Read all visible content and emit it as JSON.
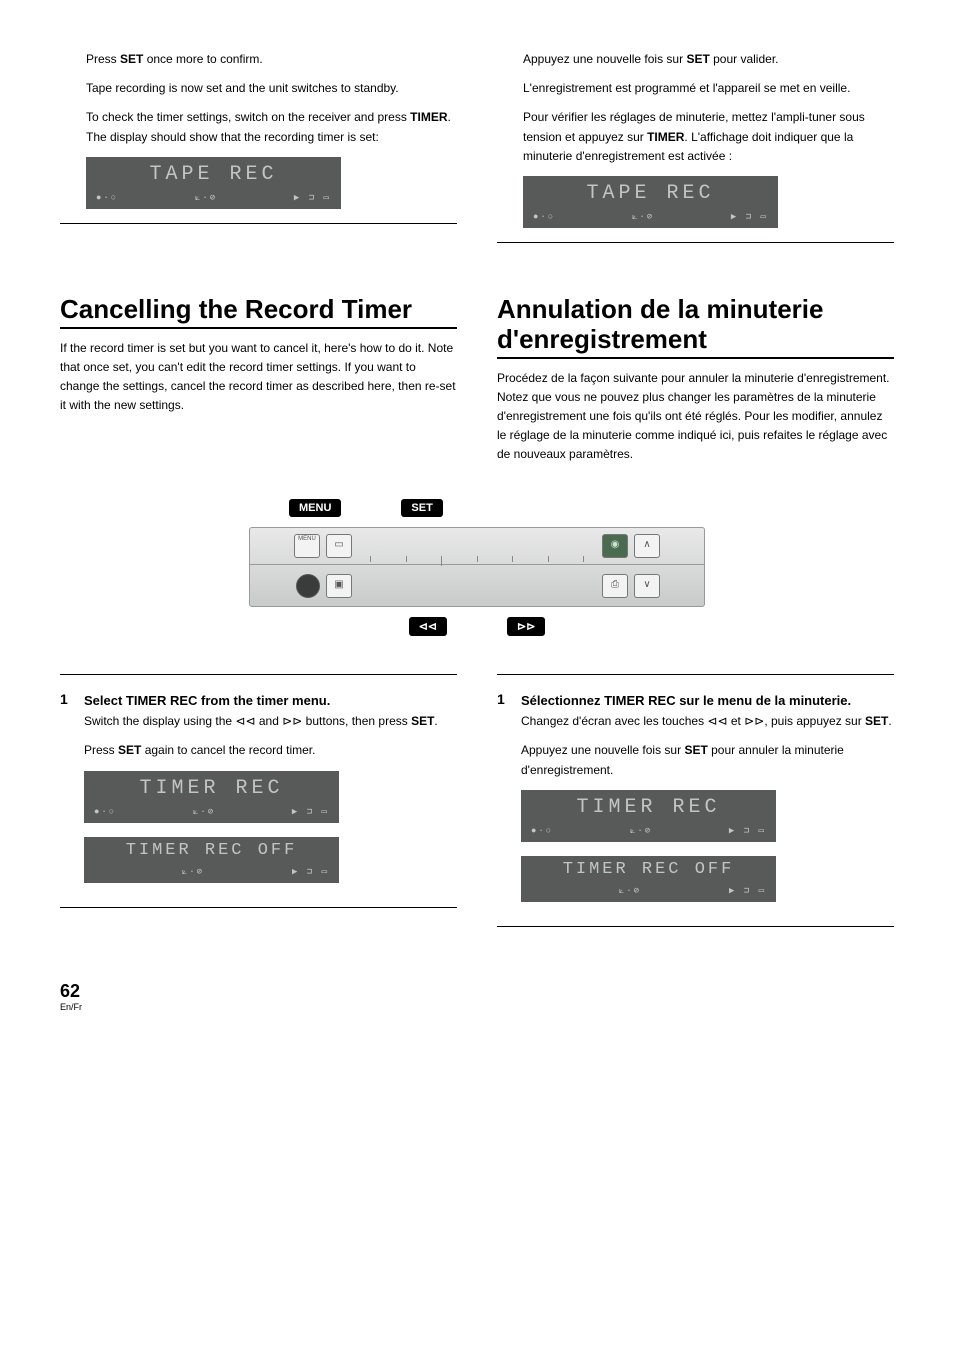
{
  "left_top": {
    "p1_pre": "Press ",
    "p1_bold": "SET",
    "p1_post": " once more to confirm.",
    "p2": "Tape recording is now set and the unit switches to standby.",
    "p3_pre": "To check the timer settings, switch on the receiver and press ",
    "p3_bold": "TIMER",
    "p3_post": ". The display should show that the recording timer is set:",
    "lcd": "TAPE REC"
  },
  "right_top": {
    "p1_pre": "Appuyez une nouvelle fois sur ",
    "p1_bold": "SET",
    "p1_post": " pour valider.",
    "p2": "L'enregistrement est programmé et l'appareil se met en veille.",
    "p3_pre": "Pour vérifier les réglages de minuterie, mettez l'ampli-tuner sous tension et appuyez sur ",
    "p3_bold": "TIMER",
    "p3_post": ". L'affichage doit indiquer que la minuterie d'enregistrement est activée :",
    "lcd": "TAPE REC"
  },
  "left_section": {
    "heading": "Cancelling the Record Timer",
    "para": "If the record timer is set but you want to cancel it, here's how to do it. Note that once set, you can't edit the record timer settings. If you want to change the settings, cancel the record timer as described here, then re-set it with the new settings.",
    "step": {
      "num": "1",
      "title": "Select TIMER REC from the timer menu.",
      "line1_pre": "Switch the display using the ",
      "line1_sym1": "⊳⊳",
      "line1_mid": " and ",
      "line1_sym2": "⊲⊲",
      "line1_post": " buttons, then press ",
      "line1_bold": "SET",
      "line1_end": ".",
      "line2_pre": "Press ",
      "line2_bold": "SET",
      "line2_post": " again to cancel the record timer.",
      "lcd1": "TIMER REC",
      "lcd2": "TIMER REC OFF"
    }
  },
  "right_section": {
    "heading": "Annulation de la minuterie d'enregistrement",
    "para": "Procédez de la façon suivante pour annuler la minuterie d'enregistrement. Notez que vous ne pouvez plus changer les paramètres de la minuterie d'enregistrement une fois qu'ils ont été réglés. Pour les modifier, annulez le réglage de la minuterie comme indiqué ici, puis refaites le réglage avec de nouveaux paramètres.",
    "step": {
      "num": "1",
      "title": "Sélectionnez TIMER REC sur le menu de la minuterie.",
      "line1_pre": "Changez d'écran avec les touches ",
      "line1_sym1": "⊲⊲",
      "line1_mid": " et ",
      "line1_sym2": "⊳⊳",
      "line1_post": ", puis appuyez sur ",
      "line1_bold": "SET",
      "line1_end": ".",
      "line2_pre": "Appuyez une nouvelle fois sur ",
      "line2_bold": "SET",
      "line2_post": " pour annuler la minuterie d'enregistrement.",
      "lcd1": "TIMER REC",
      "lcd2": "TIMER REC OFF"
    }
  },
  "remote": {
    "label_menu": "MENU",
    "label_set": "SET",
    "label_prev": "⊲⊲",
    "label_next": "⊳⊳"
  },
  "lcd_icons": {
    "left": "●·○",
    "mid": "⟀·⊘",
    "right": "▶ ⊐ ▭"
  },
  "footer": {
    "page": "62",
    "langs": "En/Fr"
  }
}
